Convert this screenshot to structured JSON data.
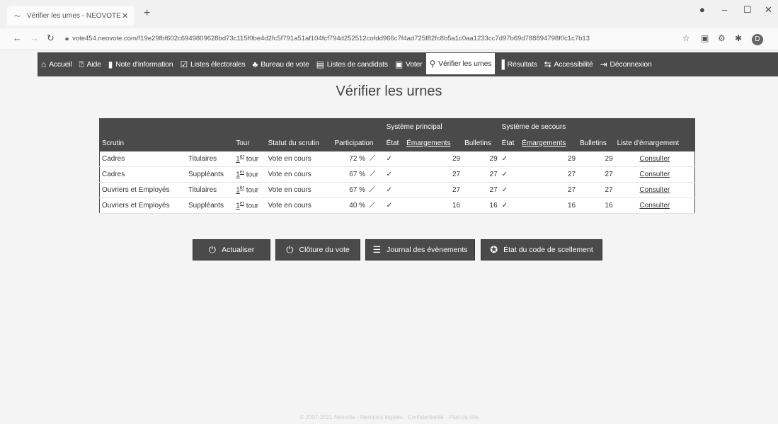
{
  "browser": {
    "tab_title": "Vérifier les urnes - NEOVOTE",
    "url": "vote454.neovote.com/f19e29fbf602c6949809628bd73c115f0be4d2fc5f791a51af104fcf794d252512cofdd966c7f4ad725f82fc8b5a1c0aa1233cc7d97b69d788894798f0c1c7b13",
    "profile_initial": "D"
  },
  "nav": {
    "items": [
      {
        "label": "Accueil",
        "icon": "home-icon"
      },
      {
        "label": "Aide",
        "icon": "help-icon"
      },
      {
        "label": "Note d'information",
        "icon": "document-icon"
      },
      {
        "label": "Listes électorales",
        "icon": "list-check-icon"
      },
      {
        "label": "Bureau de vote",
        "icon": "people-icon"
      },
      {
        "label": "Listes de candidats",
        "icon": "book-icon"
      },
      {
        "label": "Voter",
        "icon": "ballot-icon"
      },
      {
        "label": "Vérifier les urnes",
        "icon": "magnifier-icon"
      },
      {
        "label": "Résultats",
        "icon": "bar-chart-icon"
      },
      {
        "label": "Accessibilité",
        "icon": "accessibility-icon"
      },
      {
        "label": "Déconnexion",
        "icon": "logout-icon"
      }
    ]
  },
  "page": {
    "title": "Vérifier les urnes"
  },
  "table": {
    "group_main": "Système principal",
    "group_backup": "Système de secours",
    "headers": {
      "scrutin": "Scrutin",
      "tour": "Tour",
      "statut": "Statut du scrutin",
      "participation": "Participation",
      "etat": "État",
      "emargements": "Émargements",
      "bulletins": "Bulletins",
      "etat2": "État",
      "emargements2": "Émargements",
      "bulletins2": "Bulletins",
      "liste": "Liste d'émargement"
    },
    "rows": [
      {
        "college": "Cadres",
        "type": "Titulaires",
        "tour_num": "1",
        "tour_sup": "er",
        "tour_word": "tour",
        "statut": "Vote en cours",
        "participation": "72 %",
        "emarg": "29",
        "bull": "29",
        "emarg2": "29",
        "bull2": "29",
        "link": "Consulter"
      },
      {
        "college": "Cadres",
        "type": "Suppléants",
        "tour_num": "1",
        "tour_sup": "er",
        "tour_word": "tour",
        "statut": "Vote en cours",
        "participation": "67 %",
        "emarg": "27",
        "bull": "27",
        "emarg2": "27",
        "bull2": "27",
        "link": "Consulter"
      },
      {
        "college": "Ouvriers et Employés",
        "type": "Titulaires",
        "tour_num": "1",
        "tour_sup": "er",
        "tour_word": "tour",
        "statut": "Vote en cours",
        "participation": "67 %",
        "emarg": "27",
        "bull": "27",
        "emarg2": "27",
        "bull2": "27",
        "link": "Consulter"
      },
      {
        "college": "Ouvriers et Employés",
        "type": "Suppléants",
        "tour_num": "1",
        "tour_sup": "er",
        "tour_word": "tour",
        "statut": "Vote en cours",
        "participation": "40 %",
        "emarg": "16",
        "bull": "16",
        "emarg2": "16",
        "bull2": "16",
        "link": "Consulter"
      }
    ]
  },
  "buttons": {
    "refresh": "Actualiser",
    "close_vote": "Clôture du vote",
    "journal": "Journal des évènements",
    "seal": "État du code de scellement"
  },
  "footer": "© 2007-2021 Neovote · Mentions légales · Confidentialité · Plan du site"
}
